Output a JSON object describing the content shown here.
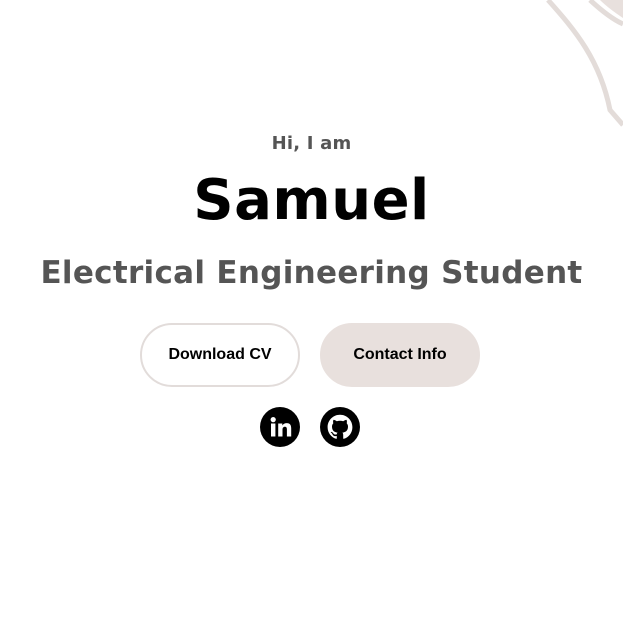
{
  "hero": {
    "greeting": "Hi, I am",
    "name": "Samuel",
    "role": "Electrical Engineering Student"
  },
  "actions": {
    "download_cv_label": "Download CV",
    "contact_info_label": "Contact Info"
  },
  "social": {
    "items": [
      {
        "icon": "linkedin-icon"
      },
      {
        "icon": "github-icon"
      }
    ]
  },
  "colors": {
    "text_primary": "#000000",
    "text_secondary": "#555555",
    "accent_fill": "#e8e0dd",
    "accent_border": "#e2dcda",
    "decor_stroke": "#e3dcd9"
  }
}
